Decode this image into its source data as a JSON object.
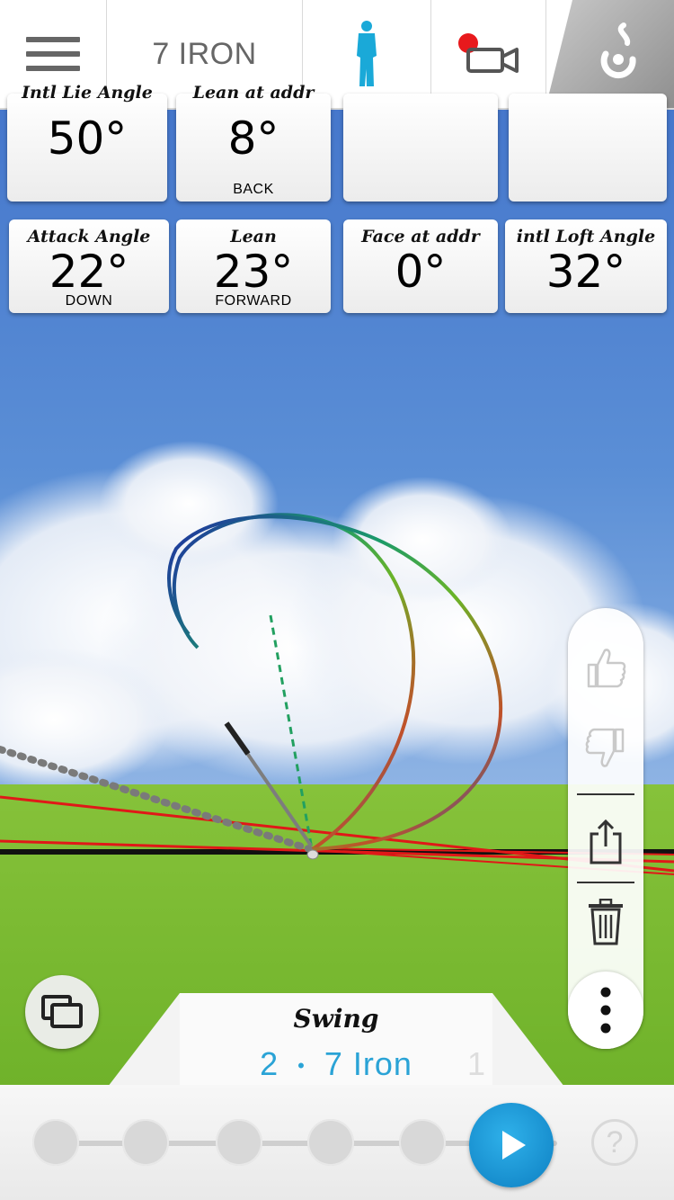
{
  "toolbar": {
    "club": "7 IRON",
    "menu_icon": "hamburger-icon",
    "golfer_icon": "golfer-silhouette-icon",
    "video_icon": "record-video-icon",
    "logo_icon": "brand-swirl-logo",
    "colors": {
      "golfer": "#1aa9d8",
      "record": "#e8191c",
      "logo_bg": "#a6a6a6"
    }
  },
  "stats_row1": [
    {
      "label": "Intl Lie Angle",
      "value": "50°",
      "sub": ""
    },
    {
      "label": "Lean at addr",
      "value": "8°",
      "sub": "BACK"
    },
    {
      "label": "",
      "value": "",
      "sub": ""
    },
    {
      "label": "",
      "value": "",
      "sub": ""
    }
  ],
  "stats_row2": [
    {
      "label": "Attack Angle",
      "value": "22°",
      "sub": "DOWN"
    },
    {
      "label": "Lean",
      "value": "23°",
      "sub": "FORWARD"
    },
    {
      "label": "Face at addr",
      "value": "0°",
      "sub": ""
    },
    {
      "label": "intl Loft Angle",
      "value": "32°",
      "sub": ""
    }
  ],
  "side_actions": {
    "like_icon": "thumbs-up-icon",
    "dislike_icon": "thumbs-down-icon",
    "share_icon": "share-icon",
    "delete_icon": "trash-icon",
    "more_icon": "more-vertical-icon"
  },
  "swing_tab": {
    "title": "Swing",
    "number": "2",
    "separator": "•",
    "club": "7 Iron",
    "next_number": "1"
  },
  "timeline": {
    "positions": 5,
    "play_icon": "play-icon",
    "help_label": "?",
    "accent": "#1a90d2"
  }
}
